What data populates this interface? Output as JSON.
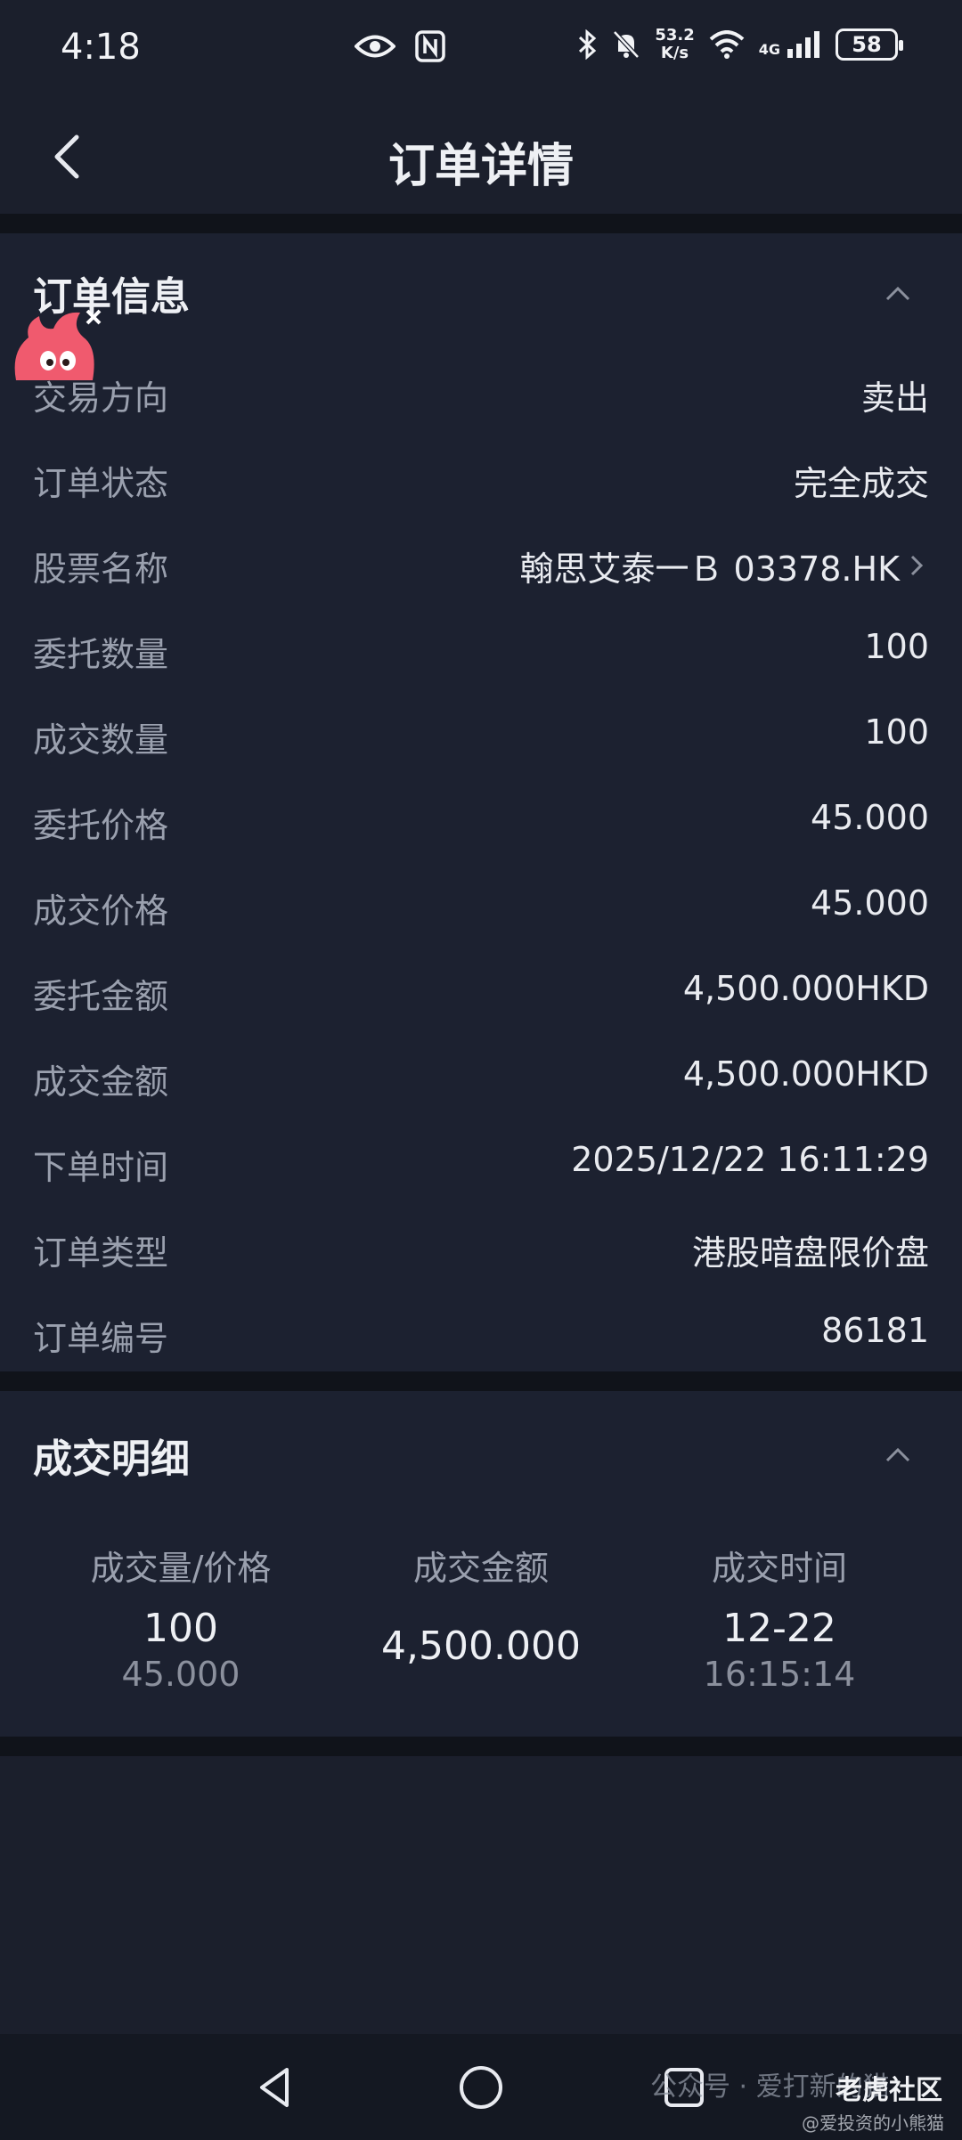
{
  "status_bar": {
    "time": "4:18",
    "network_speed": "53.2",
    "network_speed_unit": "K/s",
    "signal_label": "4G",
    "battery": "58"
  },
  "header": {
    "title": "订单详情"
  },
  "order_info": {
    "section_title": "订单信息",
    "rows": [
      {
        "label": "交易方向",
        "value": "卖出"
      },
      {
        "label": "订单状态",
        "value": "完全成交"
      },
      {
        "label": "股票名称",
        "value": "翰思艾泰一Ｂ  03378.HK"
      },
      {
        "label": "委托数量",
        "value": "100"
      },
      {
        "label": "成交数量",
        "value": "100"
      },
      {
        "label": "委托价格",
        "value": "45.000"
      },
      {
        "label": "成交价格",
        "value": "45.000"
      },
      {
        "label": "委托金额",
        "value": "4,500.000HKD"
      },
      {
        "label": "成交金额",
        "value": "4,500.000HKD"
      },
      {
        "label": "下单时间",
        "value": "2025/12/22 16:11:29"
      },
      {
        "label": "订单类型",
        "value": "港股暗盘限价盘"
      },
      {
        "label": "订单编号",
        "value": "86181"
      }
    ]
  },
  "fill_details": {
    "section_title": "成交明细",
    "columns": [
      "成交量/价格",
      "成交金额",
      "成交时间"
    ],
    "fills": [
      {
        "qty": "100",
        "price": "45.000",
        "amount": "4,500.000",
        "date": "12-22",
        "time": "16:15:14"
      }
    ]
  },
  "watermark": {
    "text": "公众号 · 爱打新的猫",
    "brand": "老虎社区",
    "handle": "@爱投资的小熊猫"
  },
  "colors": {
    "background": "#1b1f2c",
    "card": "#1c2130",
    "divider": "#10131a",
    "label": "#9aa0ae",
    "value": "#e9ebf0"
  }
}
